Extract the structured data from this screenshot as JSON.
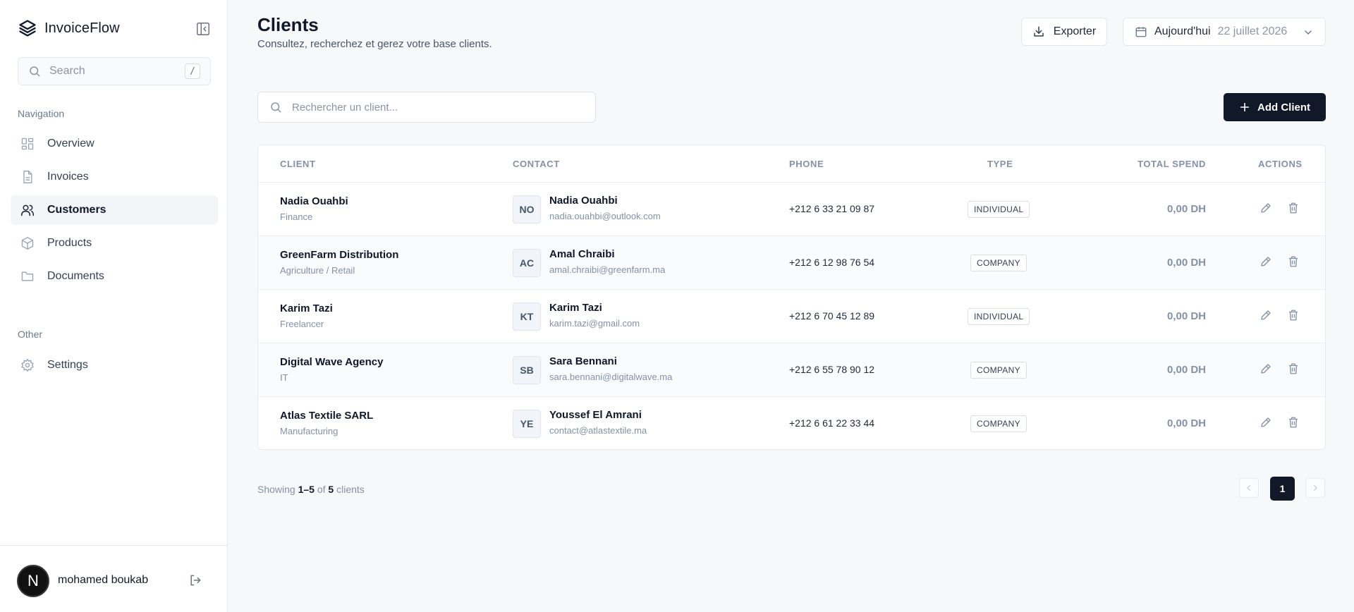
{
  "app": {
    "name": "InvoiceFlow"
  },
  "sidebar": {
    "search_placeholder": "Search",
    "search_shortcut": "/",
    "nav_section": "Navigation",
    "items": [
      {
        "label": "Overview",
        "icon": "grid-icon"
      },
      {
        "label": "Invoices",
        "icon": "file-icon"
      },
      {
        "label": "Customers",
        "icon": "users-icon",
        "active": true
      },
      {
        "label": "Products",
        "icon": "box-icon"
      },
      {
        "label": "Documents",
        "icon": "folder-icon"
      }
    ],
    "other_section": "Other",
    "other_items": [
      {
        "label": "Settings",
        "icon": "gear-icon"
      }
    ],
    "user": {
      "initial": "N",
      "name": "mohamed boukab"
    }
  },
  "header": {
    "title": "Clients",
    "subtitle": "Consultez, recherchez et gerez votre base clients.",
    "export_label": "Exporter",
    "date_label": "Aujourd'hui",
    "date_value": "22 juillet 2026"
  },
  "toolbar": {
    "search_placeholder": "Rechercher un client...",
    "add_label": "Add Client"
  },
  "table": {
    "columns": [
      "CLIENT",
      "CONTACT",
      "PHONE",
      "TYPE",
      "TOTAL SPEND",
      "ACTIONS"
    ],
    "rows": [
      {
        "name": "Nadia Ouahbi",
        "sector": "Finance",
        "initials": "NO",
        "contact": "Nadia Ouahbi",
        "email": "nadia.ouahbi@outlook.com",
        "phone": "+212 6 33 21 09 87",
        "type": "INDIVIDUAL",
        "spend": "0,00 DH"
      },
      {
        "name": "GreenFarm Distribution",
        "sector": "Agriculture / Retail",
        "initials": "AC",
        "contact": "Amal Chraibi",
        "email": "amal.chraibi@greenfarm.ma",
        "phone": "+212 6 12 98 76 54",
        "type": "COMPANY",
        "spend": "0,00 DH"
      },
      {
        "name": "Karim Tazi",
        "sector": "Freelancer",
        "initials": "KT",
        "contact": "Karim Tazi",
        "email": "karim.tazi@gmail.com",
        "phone": "+212 6 70 45 12 89",
        "type": "INDIVIDUAL",
        "spend": "0,00 DH"
      },
      {
        "name": "Digital Wave Agency",
        "sector": "IT",
        "initials": "SB",
        "contact": "Sara Bennani",
        "email": "sara.bennani@digitalwave.ma",
        "phone": "+212 6 55 78 90 12",
        "type": "COMPANY",
        "spend": "0,00 DH"
      },
      {
        "name": "Atlas Textile SARL",
        "sector": "Manufacturing",
        "initials": "YE",
        "contact": "Youssef El Amrani",
        "email": "contact@atlastextile.ma",
        "phone": "+212 6 61 22 33 44",
        "type": "COMPANY",
        "spend": "0,00 DH"
      }
    ]
  },
  "footer": {
    "showing": "Showing",
    "range": "1–5",
    "of": "of",
    "total": "5",
    "unit": "clients",
    "current_page": "1"
  },
  "colors": {
    "primary": "#111827",
    "muted": "#8391a7",
    "background": "#f7f8fa"
  }
}
